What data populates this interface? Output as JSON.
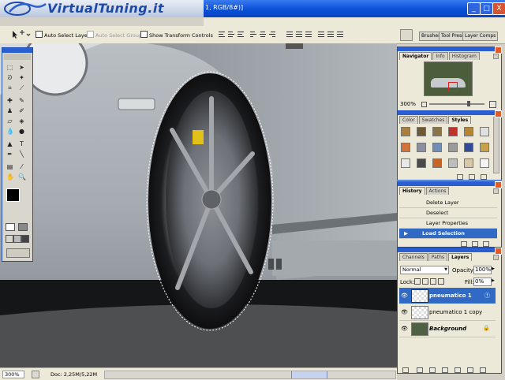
{
  "titlebar": {
    "logo_text": "VirtualTuning.it",
    "title_suffix": "1, RGB/8#)]",
    "buttons": [
      "_",
      "□",
      "X"
    ]
  },
  "options": {
    "auto_select_layer": "Auto Select Layer",
    "auto_select_groups": "Auto Select Groups",
    "show_transform_controls": "Show Transform Controls",
    "palette_well_tabs": [
      "Brushes",
      "Tool Presets",
      "Layer Comps"
    ]
  },
  "colors": {
    "xp_blue": "#0a4fd6",
    "chrome": "#ece9d8",
    "selected_row": "#316ac5"
  },
  "navigator": {
    "tabs": [
      "Navigator",
      "Info",
      "Histogram"
    ],
    "zoom": "300%"
  },
  "styles": {
    "tabs": [
      "Color",
      "Swatches",
      "Styles"
    ],
    "swatches": [
      "#a87f3e",
      "#6d5a33",
      "#8b7346",
      "#c0312b",
      "#b58532",
      "#e0e0e0",
      "#d2743a",
      "#8b8fa0",
      "#6f8fb8",
      "#9a9a9a",
      "#334a9b",
      "#c8a24a",
      "#e8e8e8",
      "#4a4a4a",
      "#c86426",
      "#bdbdbd",
      "#d9c7a6",
      "#f4f4f4"
    ]
  },
  "history": {
    "tabs": [
      "History",
      "Actions"
    ],
    "items": [
      "Delete Layer",
      "Deselect",
      "Layer Properties",
      "Load Selection"
    ],
    "selected_index": 3
  },
  "layers": {
    "tabs": [
      "Channels",
      "Paths",
      "Layers"
    ],
    "blend_mode": "Normal",
    "opacity_label": "Opacity:",
    "opacity_value": "100%",
    "lock_label": "Lock:",
    "fill_label": "Fill:",
    "fill_value": "0%",
    "items": [
      "pneumatico 1",
      "pneumatico 1 copy",
      "Background"
    ],
    "selected_index": 0
  },
  "status": {
    "zoom": "300%",
    "doc": "Doc: 2,25M/5,22M"
  }
}
